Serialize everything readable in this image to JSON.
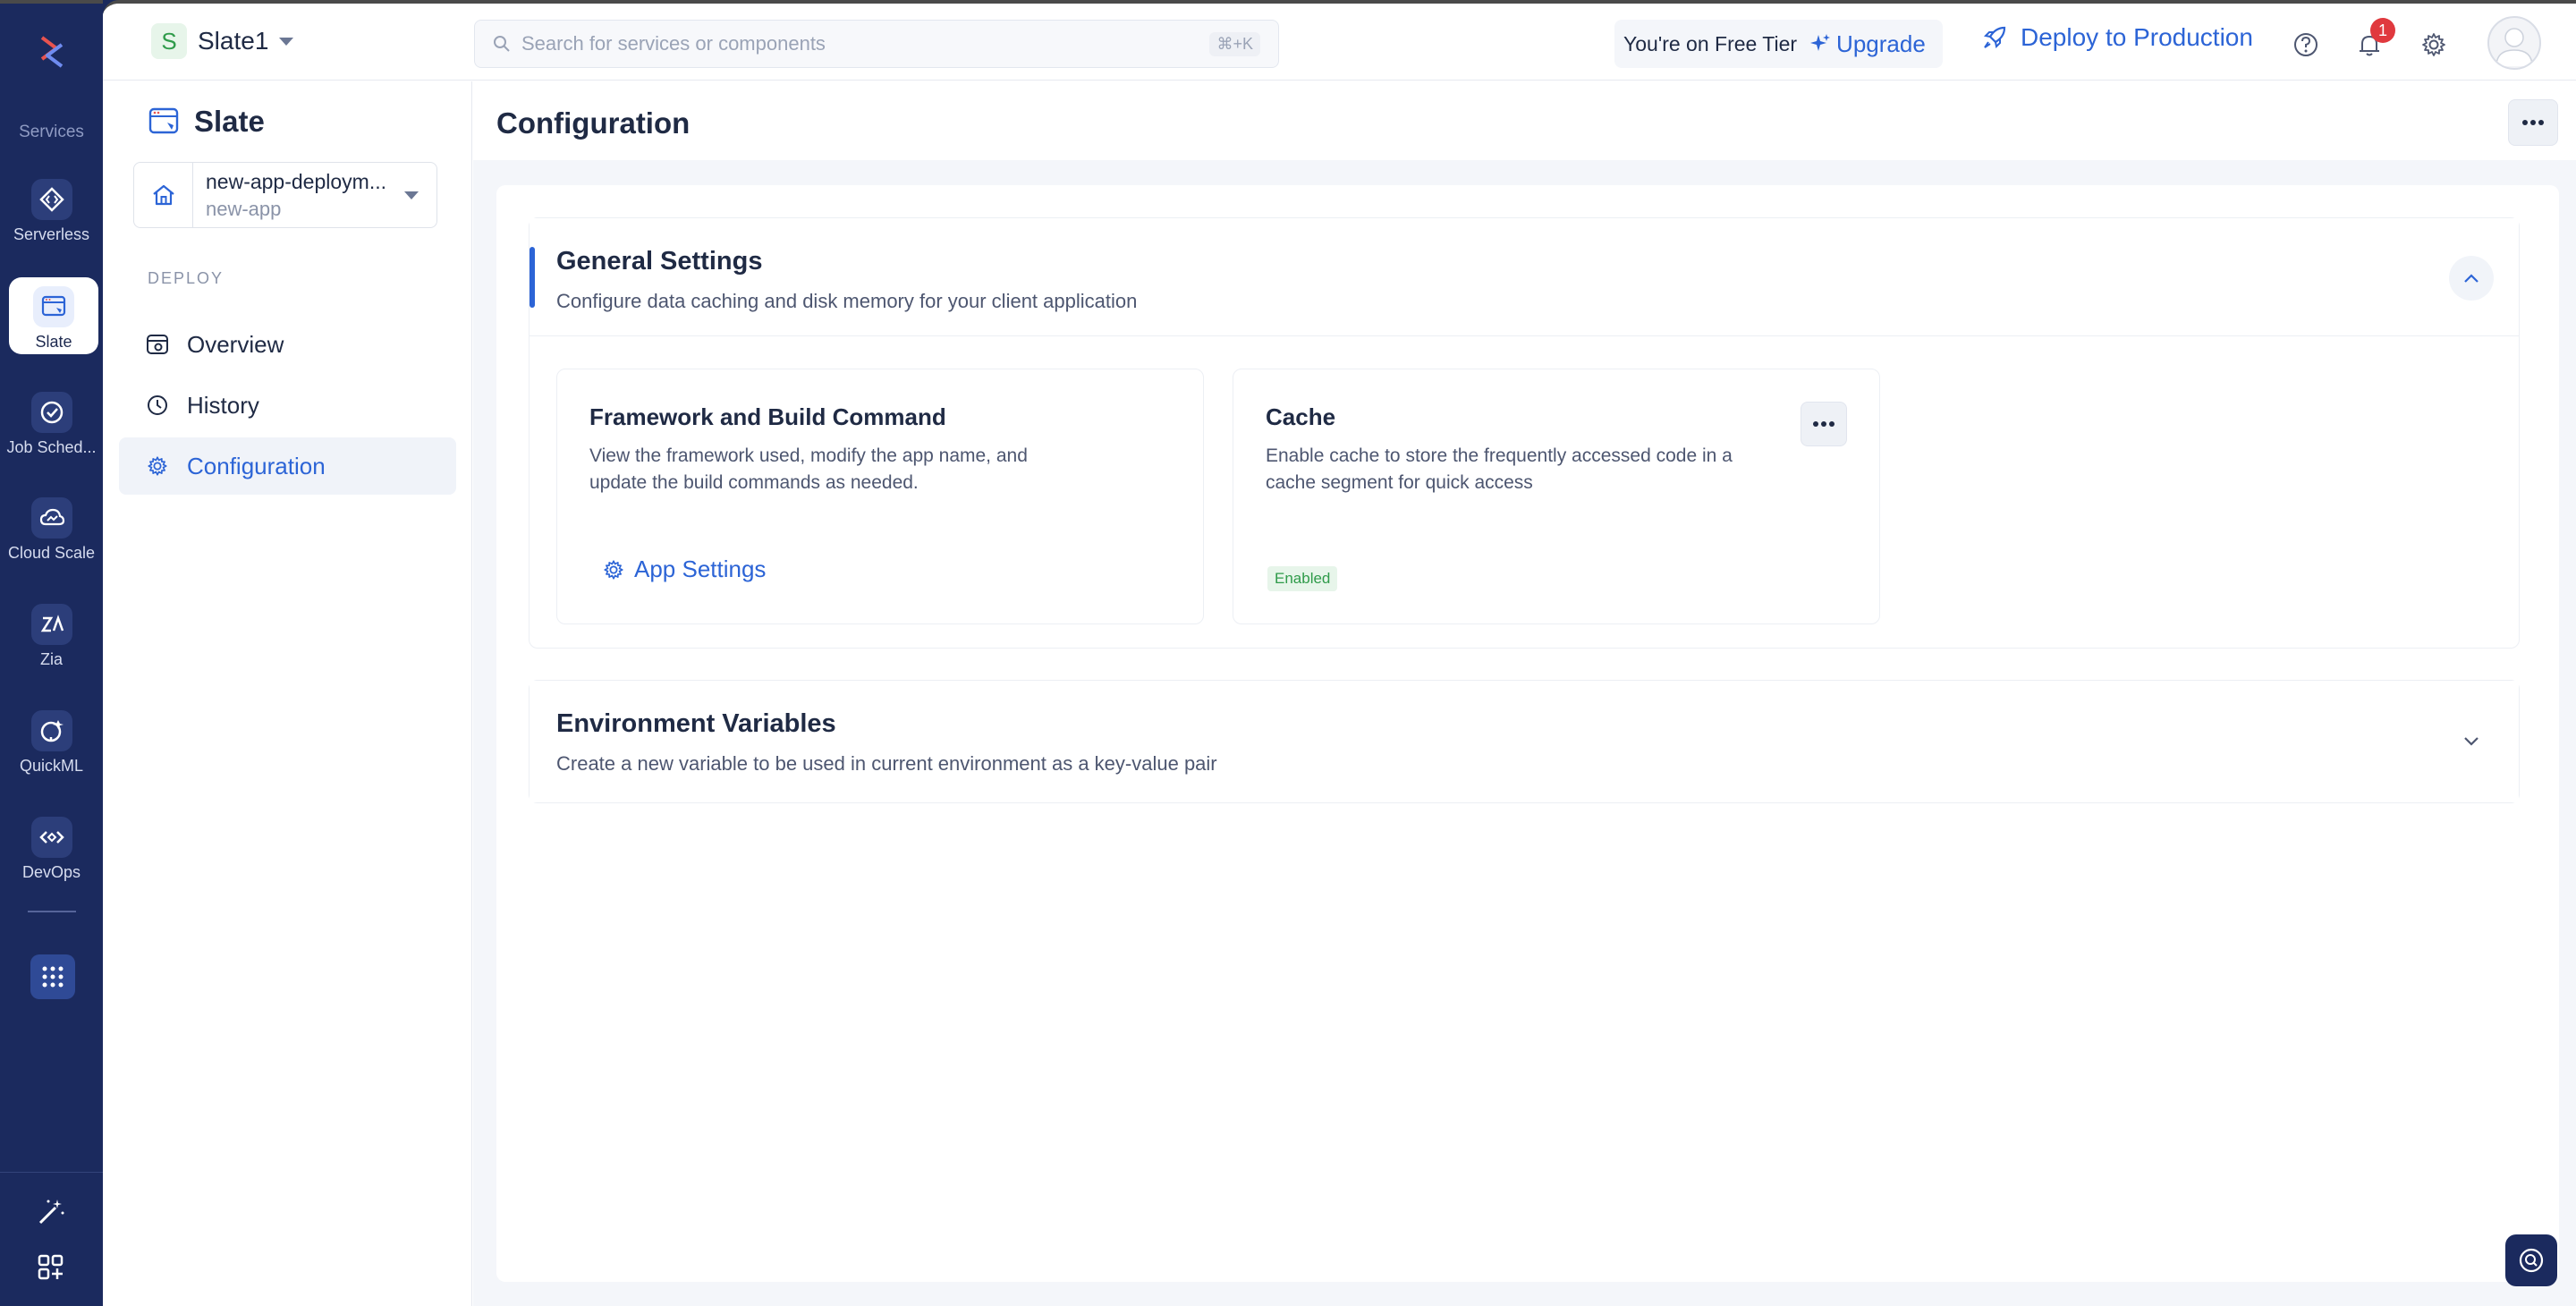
{
  "rail": {
    "heading": "Services",
    "items": [
      {
        "label": "Serverless",
        "icon": "code-brackets-icon"
      },
      {
        "label": "Slate",
        "icon": "slate-browser-icon"
      },
      {
        "label": "Job Sched...",
        "icon": "job-scheduler-icon"
      },
      {
        "label": "Cloud Scale",
        "icon": "cloud-scale-icon"
      },
      {
        "label": "Zia",
        "icon": "zia-icon"
      },
      {
        "label": "QuickML",
        "icon": "quickml-icon"
      },
      {
        "label": "DevOps",
        "icon": "devops-icon"
      }
    ]
  },
  "header": {
    "project_initial": "S",
    "project_name": "Slate1",
    "search_placeholder": "Search for services or components",
    "search_shortcut": "⌘+K",
    "tier_text": "You're on Free Tier",
    "upgrade_label": "Upgrade",
    "deploy_label": "Deploy to Production",
    "notification_count": "1"
  },
  "sidenav": {
    "service_title": "Slate",
    "env_name": "new-app-deploym...",
    "env_sub": "new-app",
    "section_label": "DEPLOY",
    "items": [
      {
        "label": "Overview"
      },
      {
        "label": "History"
      },
      {
        "label": "Configuration"
      }
    ]
  },
  "page": {
    "title": "Configuration",
    "general": {
      "title": "General Settings",
      "description": "Configure data caching and disk memory for your client application",
      "cards": [
        {
          "title": "Framework and Build Command",
          "description": "View the framework used, modify the app name, and update the build commands as needed.",
          "link": "App Settings"
        },
        {
          "title": "Cache",
          "description": "Enable cache to store the frequently accessed code in a cache segment for quick access",
          "status": "Enabled"
        }
      ]
    },
    "env_vars": {
      "title": "Environment Variables",
      "description": "Create a new variable to be used in current environment as a key-value pair"
    }
  },
  "colors": {
    "accent": "#2c64d6",
    "rail_bg": "#1b2a5e",
    "success": "#2f9b4a",
    "alert": "#e0393e"
  }
}
